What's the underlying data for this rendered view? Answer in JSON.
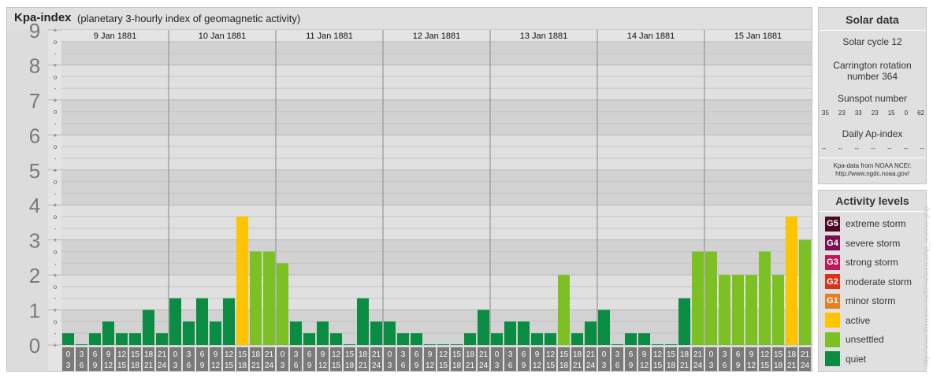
{
  "header": {
    "title": "Kpa-index",
    "subtitle": "(planetary 3-hourly index of geomagnetic activity)"
  },
  "chart_data": {
    "type": "bar",
    "title": "Kpa-index",
    "subtitle": "(planetary 3-hourly index of geomagnetic activity)",
    "ylim": [
      0,
      9
    ],
    "y_ticks": [
      "0",
      "1",
      "2",
      "3",
      "4",
      "5",
      "6",
      "7",
      "8",
      "9"
    ],
    "y_minor_labels": [
      "o",
      "+",
      "-"
    ],
    "days": [
      "9 Jan 1881",
      "10 Jan 1881",
      "11 Jan 1881",
      "12 Jan 1881",
      "13 Jan 1881",
      "14 Jan 1881",
      "15 Jan 1881"
    ],
    "interval_starts": [
      "0",
      "3",
      "6",
      "9",
      "12",
      "15",
      "18",
      "21"
    ],
    "interval_ends": [
      "3",
      "6",
      "9",
      "12",
      "15",
      "18",
      "21",
      "24"
    ],
    "values": [
      0.333,
      0,
      0.333,
      0.667,
      0.333,
      0.333,
      1,
      0.333,
      1.333,
      0.667,
      1.333,
      0.667,
      1.333,
      3.667,
      2.667,
      2.667,
      2.333,
      0.667,
      0.333,
      0.667,
      0.333,
      0,
      1.333,
      0.667,
      0.667,
      0.333,
      0.333,
      0,
      0,
      0,
      0.333,
      1,
      0.333,
      0.667,
      0.667,
      0.333,
      0.333,
      2,
      0.333,
      0.667,
      1,
      0,
      0.333,
      0.333,
      0,
      0,
      1.333,
      2.667,
      2.667,
      2,
      2,
      2,
      2.667,
      2,
      3.667,
      3
    ],
    "colors": {
      "quiet": "#0a8c43",
      "unsettled": "#7cc023",
      "active": "#ffc400",
      "minor_storm": "#e67e22",
      "moderate_storm": "#d9331c",
      "strong_storm": "#c2185b",
      "severe_storm": "#7a1050",
      "extreme_storm": "#4a0a26"
    },
    "thresholds": {
      "unsettled": 2,
      "active": 3.5
    }
  },
  "solar": {
    "title": "Solar data",
    "cycle": "Solar cycle 12",
    "carrington_line1": "Carrington rotation",
    "carrington_line2": "number 364",
    "sunspot_title": "Sunspot number",
    "sunspot_values": [
      "35",
      "23",
      "33",
      "23",
      "15",
      "0",
      "62"
    ],
    "ap_title": "Daily Ap-index",
    "ap_values": [
      "--",
      "--",
      "--",
      "--",
      "--",
      "--",
      "--"
    ],
    "source_line1": "Kpa-data from NOAA NCEI:",
    "source_line2": "http://www.ngdc.noaa.gov/"
  },
  "levels": {
    "title": "Activity levels",
    "items": [
      {
        "badge": "G5",
        "label": "extreme storm",
        "color": "#4a0a26"
      },
      {
        "badge": "G4",
        "label": "severe storm",
        "color": "#7a1050"
      },
      {
        "badge": "G3",
        "label": "strong storm",
        "color": "#c2185b"
      },
      {
        "badge": "G2",
        "label": "moderate storm",
        "color": "#d9331c"
      },
      {
        "badge": "G1",
        "label": "minor storm",
        "color": "#e67e22"
      },
      {
        "badge": "",
        "label": "active",
        "color": "#ffc400"
      },
      {
        "badge": "",
        "label": "unsettled",
        "color": "#7cc023"
      },
      {
        "badge": "",
        "label": "quiet",
        "color": "#0a8c43"
      }
    ]
  },
  "credit": "http://www.theusner.eu/ferra/aurora/kp_archive.php"
}
